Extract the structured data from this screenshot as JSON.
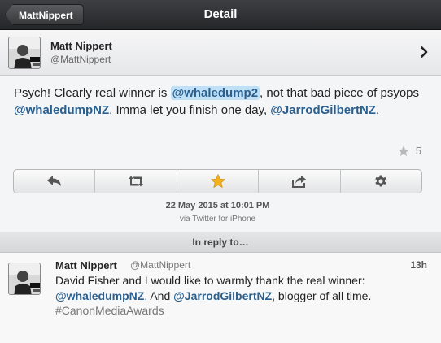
{
  "navbar": {
    "back_label": "MattNippert",
    "title": "Detail"
  },
  "tweet": {
    "author_name": "Matt Nippert",
    "author_handle": "@MattNippert",
    "text_parts": {
      "p1": "Psych! Clearly real winner is ",
      "m1": "@whaledump2",
      "p2": ", not that bad piece of psyops ",
      "m2": "@whaledumpNZ",
      "p3": ". Imma let you finish one day, ",
      "m3": "@JarrodGilbertNZ",
      "p4": "."
    },
    "favorite_count": "5",
    "timestamp": "22 May 2015 at 10:01 PM",
    "via": "via Twitter for iPhone"
  },
  "actions": {
    "icons": [
      "reply-icon",
      "retweet-icon",
      "favorite-star-icon",
      "share-icon",
      "settings-gear-icon"
    ]
  },
  "reply_section": {
    "header": "In reply to…",
    "author_name": "Matt Nippert",
    "author_handle": "@MattNippert",
    "time_ago": "13h",
    "text_parts": {
      "p1": "David Fisher and I would like to warmly thank the real winner: ",
      "m1": "@whaledumpNZ",
      "p2": ". And ",
      "m2": "@JarrodGilbertNZ",
      "p3": ", blogger of all time. ",
      "h1": "#CanonMediaAwards"
    }
  },
  "colors": {
    "mention": "#2b5f8e",
    "highlight": "#bfe0f6",
    "star_active": "#f3b21b",
    "navbar": "#2e2f31"
  }
}
